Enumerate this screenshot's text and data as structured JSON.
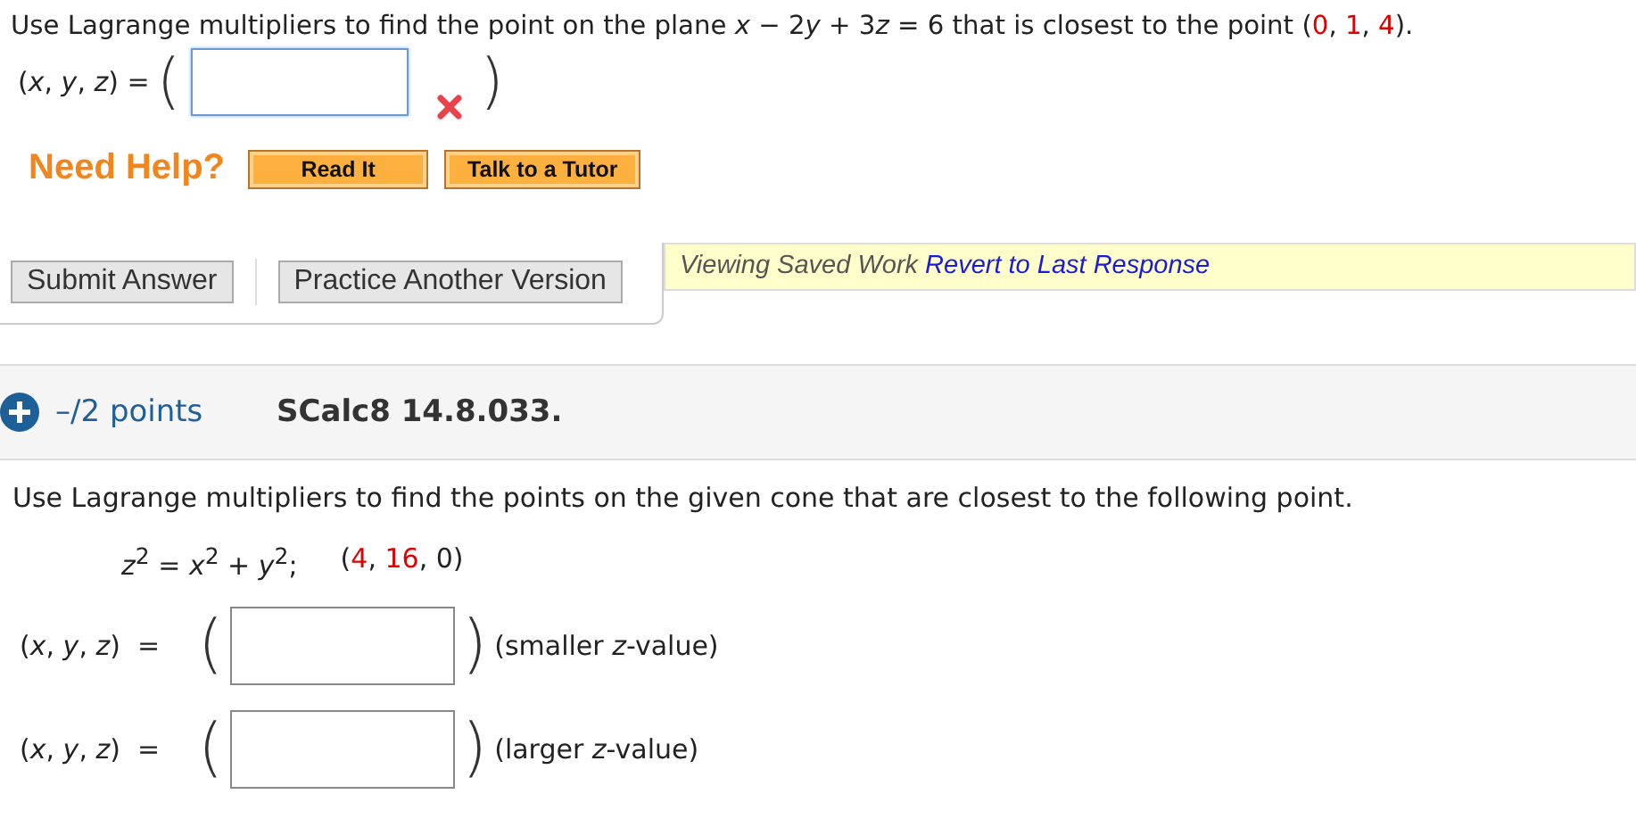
{
  "question1": {
    "prompt": "Use Lagrange multipliers to find the point on the plane ",
    "equation": [
      {
        "text": "x",
        "kind": "var"
      },
      {
        "text": " − 2",
        "kind": "plain"
      },
      {
        "text": "y",
        "kind": "var"
      },
      {
        "text": " + 3",
        "kind": "plain"
      },
      {
        "text": "z",
        "kind": "var"
      },
      {
        "text": " = 6",
        "kind": "plain"
      }
    ],
    "prompt_end": " that is closest to the point ",
    "point": [
      {
        "text": "(",
        "color": "#222222"
      },
      {
        "text": "0",
        "color": "#e00000"
      },
      {
        "text": ", ",
        "color": "#222222"
      },
      {
        "text": "1",
        "color": "#e00000"
      },
      {
        "text": ", ",
        "color": "#222222"
      },
      {
        "text": "4",
        "color": "#e00000"
      },
      {
        "text": ").",
        "color": "#222222"
      }
    ],
    "answer_label": "(*x*, *y*, *z*) =",
    "open": "(",
    "close": ")",
    "answer": {
      "focused": true,
      "incorrect": true
    }
  },
  "help": {
    "label": "Need Help?",
    "buttons": [
      "Read It",
      "Talk to a Tutor"
    ]
  },
  "actions": {
    "buttons": [
      "Submit Answer",
      "Practice Another Version"
    ],
    "notice": "Viewing Saved Work",
    "notice_link": "Revert to Last Response"
  },
  "question2": {
    "points": "–/2 points",
    "code": "SCalc8 14.8.033.",
    "prompt": "Use Lagrange multipliers to find the points on the given cone that are closest to the following point.",
    "equation": "*z*$^{2}$ = *x*$^{2}$ + *y*$^{2}$;",
    "point": [
      {
        "text": "(",
        "color": "#222222"
      },
      {
        "text": "4",
        "color": "#e00000"
      },
      {
        "text": ", ",
        "color": "#222222"
      },
      {
        "text": "16",
        "color": "#e00000"
      },
      {
        "text": ", 0)",
        "color": "#222222"
      }
    ],
    "answers": [
      {
        "label": "(*x*, *y*, *z*)  =",
        "open": "(",
        "close": ")",
        "suffix": "(smaller *z*-value)"
      },
      {
        "label": "(*x*, *y*, *z*)  =",
        "open": "(",
        "close": ")",
        "suffix": "(larger *z*-value)"
      }
    ]
  }
}
